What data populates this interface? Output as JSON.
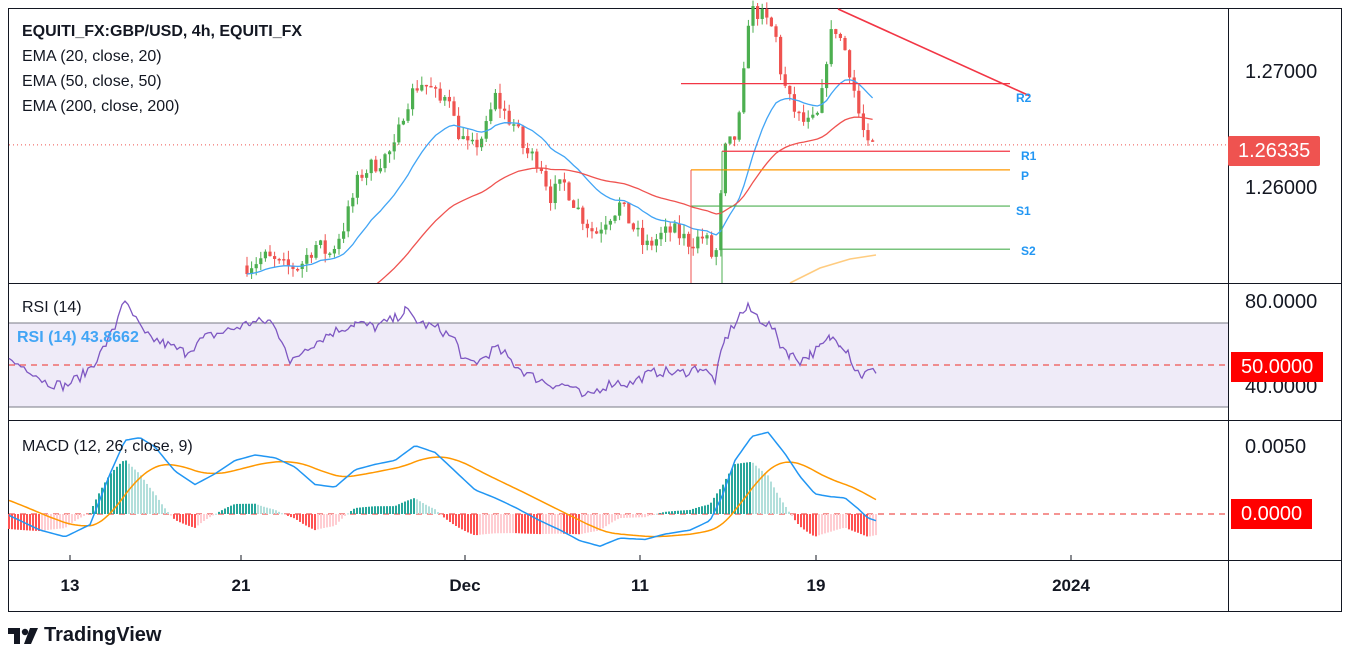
{
  "header": {
    "symbol": "EQUITI_FX:GBP/USD, 4h, EQUITI_FX",
    "ema20": "EMA (20, close, 20)",
    "ema50": "EMA (50, close, 50)",
    "ema200": "EMA (200, close, 200)"
  },
  "rsi_panel": {
    "title": "RSI (14)",
    "value_label": "RSI (14) 43.8662"
  },
  "macd_panel": {
    "title": "MACD (12, 26, close, 9)"
  },
  "footer": {
    "brand": "TradingView"
  },
  "colors": {
    "up": "#4caf50",
    "down": "#ef5350",
    "ema20": "#42a5f5",
    "ema50": "#ef5350",
    "ema200": "#ffcc80",
    "rsi": "#7e57c2",
    "macd": "#2196f3",
    "signal": "#ff9800",
    "pivot_red": "#f23645",
    "pivot_green": "#22ab94"
  },
  "chart_data": [
    {
      "type": "candlestick",
      "title": "EQUITI_FX:GBP/USD, 4h, EQUITI_FX",
      "x_tick_labels": [
        "13",
        "21",
        "Dec",
        "11",
        "19",
        "2024"
      ],
      "y_tick_labels": [
        "1.27000",
        "1.26000"
      ],
      "last_price": "1.26335",
      "series": [
        {
          "name": "EMA (20, close, 20)"
        },
        {
          "name": "EMA (50, close, 50)"
        },
        {
          "name": "EMA (200, close, 200)"
        }
      ],
      "pivot_levels": [
        {
          "label": "R2",
          "value": 1.2686
        },
        {
          "label": "R1",
          "value": 1.2628
        },
        {
          "label": "P",
          "value": 1.2612
        },
        {
          "label": "S1",
          "value": 1.2581
        },
        {
          "label": "S2",
          "value": 1.2544
        }
      ],
      "visible_range": [
        1.2515,
        1.275
      ]
    },
    {
      "type": "line",
      "title": "RSI (14)",
      "value": 43.8662,
      "y_tick_labels": [
        "80.0000",
        "50.0000",
        "40.0000"
      ],
      "band": [
        30,
        70
      ],
      "midline": 50
    },
    {
      "type": "line",
      "title": "MACD (12, 26, close, 9)",
      "y_tick_labels": [
        "0.0050",
        "0.0000"
      ],
      "zero_line": 0
    }
  ]
}
